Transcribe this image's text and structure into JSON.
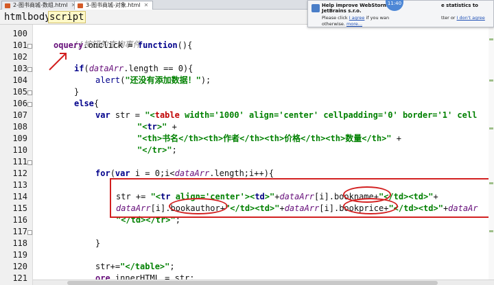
{
  "tabs": [
    {
      "label": "2-图书商城-数组.html"
    },
    {
      "label": "3-图书商城-对象.html"
    }
  ],
  "breadcrumbs": [
    "html",
    "body",
    "script"
  ],
  "notification": {
    "title": "Help improve WebStorm by",
    "title_right": "e statistics to",
    "company": "JetBrains s.r.o.",
    "line2_pre": "Please click",
    "agree": "I agree",
    "line2_mid": "if you wan",
    "line2_right": "tter or",
    "dont_agree": "I don't agree",
    "line3": "otherwise.",
    "more": "more...",
    "clock": "11:40"
  },
  "line_numbers": [
    "100",
    "101",
    "102",
    "103",
    "104",
    "105",
    "106",
    "107",
    "108",
    "109",
    "110",
    "111",
    "112",
    "113",
    "114",
    "115",
    "116",
    "117",
    "118",
    "119",
    "120",
    "121"
  ],
  "code": {
    "l100": "//按钮的查询事件",
    "l101_obj": "oquery",
    "l101_rest": ".onclick = ",
    "l101_kw": "function",
    "l101_end": "(){",
    "l103_kw": "if",
    "l103_a": "(",
    "l103_var": "dataArr",
    "l103_b": ".length == 0){",
    "l104_fn": "alert",
    "l104_a": "(",
    "l104_str": "\"还没有添加数据！\"",
    "l104_b": ");",
    "l105": "}",
    "l106_kw": "else",
    "l106_b": "{",
    "l107_kw": "var",
    "l107_a": " str = ",
    "l107_s1": "\"<",
    "l107_tag": "table",
    "l107_s2": " width='1000' align='center' cellpadding='0' border='1' cell",
    "l108_s1": "\"<",
    "l108_tag": "tr",
    "l108_s2": ">\"",
    "l108_b": " +",
    "l109_str": "\"<th>书名</th><th>作者</th><th>价格</th><th>数量</th>\"",
    "l109_b": " +",
    "l110_str": "\"</tr>\"",
    "l110_b": ";",
    "l112_kw1": "for",
    "l112_a": "(",
    "l112_kw2": "var",
    "l112_b": " i = 0;i<",
    "l112_var": "dataArr",
    "l112_c": ".length;i++){",
    "l114_a": "str += ",
    "l114_s1": "\"<",
    "l114_tag": "tr",
    "l114_s2": " align='center'><",
    "l114_tag2": "td",
    "l114_s3": ">\"",
    "l114_b": "+",
    "l114_var": "dataArr",
    "l114_c": "[i]",
    "l114_d": ".bookname",
    "l114_e": "+",
    "l114_s4": "\"</td><td>\"",
    "l114_f": "+",
    "l115_var": "dataArr",
    "l115_a": "[i]",
    "l115_b": ".bookauthor",
    "l115_c": "+",
    "l115_s1": "\"</td><td>\"",
    "l115_d": "+",
    "l115_var2": "dataArr",
    "l115_e": "[i]",
    "l115_f": ".bookprice",
    "l115_g": "+",
    "l115_s2": "\"</td><td>\"",
    "l115_h": "+",
    "l115_var3": "dataAr",
    "l116_str": "\"</td></tr>\"",
    "l116_b": ";",
    "l118": "}",
    "l120_a": "str+=",
    "l120_str": "\"</table>\"",
    "l120_b": ";",
    "l121_obj": "ore",
    "l121_a": ".innerHTML = str;"
  },
  "colors": {
    "keyword": "#00008b",
    "string": "#008000",
    "comment": "#8a8a8a",
    "variable": "#660e7a",
    "annotation": "#d21f1f"
  }
}
